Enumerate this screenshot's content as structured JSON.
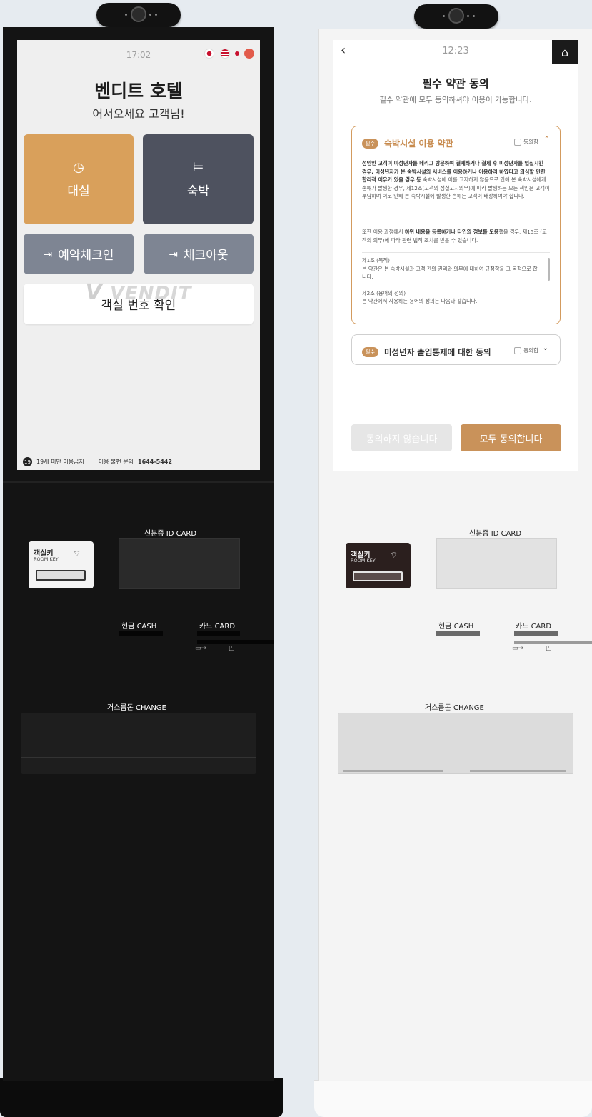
{
  "left_kiosk": {
    "status_time": "17:02",
    "flags": [
      "kr-flag",
      "us-flag",
      "jp-flag",
      "cn-flag"
    ],
    "title": "벤디트 호텔",
    "subtitle": "어서오세요 고객님!",
    "tiles": [
      {
        "label": "대실",
        "icon": "clock-icon"
      },
      {
        "label": "숙박",
        "icon": "bed-icon"
      }
    ],
    "buttons": [
      {
        "label": "예약체크인",
        "icon": "login-icon"
      },
      {
        "label": "체크아웃",
        "icon": "logout-icon"
      }
    ],
    "room_check_label": "객실 번호 확인",
    "brand": "VENDIT",
    "footer": {
      "age_badge": "19",
      "age_text": "19세 미만 이용금지",
      "contact_prefix": "이용 불편 문의",
      "contact_number": "1644-5442"
    },
    "hardware": {
      "room_key_title": "객실키",
      "room_key_sub": "ROOM KEY",
      "id_card": "신분증 ID CARD",
      "cash": "현금 CASH",
      "card": "카드 CARD",
      "change": "거스름돈 CHANGE"
    }
  },
  "right_kiosk": {
    "status_time": "12:23",
    "title": "필수 약관 동의",
    "subtitle": "필수 약관에 모두 동의하셔야 이용이 가능합니다.",
    "required_badge": "필수",
    "agree_label": "동의함",
    "terms": [
      {
        "title": "숙박시설 이용 약관",
        "expanded": true,
        "para1_bold": "성인인 고객이 미성년자를 데리고 방문하여 결제하거나 결제 후 미성년자를 입실시킨 경우, 미성년자가 본 숙박시설의 서비스를 이용하거나 이용하려 하였다고 의심할 만한 합리적 이유가 있을 경우 등",
        "para1_rest": " 숙박시설에 이를 고지하지 않음으로 인해 본 숙박시설에게 손해가 발생한 경우, 제12조(고객의 성실고지의무)에 따라 발생하는 모든 책임은 고객이 부담하며 이로 인해 본 숙박시설에 발생한 손해는 고객이 배상하여야 합니다.",
        "para2_pre": "또한 이용 과정에서 ",
        "para2_bold": "허위 내용을 등록하거나 타인의 정보를 도용",
        "para2_rest": "했을 경우, 제15조 (고객의 의무)에 따라 관련 법적 조치를 받을 수 있습니다.",
        "art1_title": "제1조 (목적)",
        "art1_text": "본 약관은 본 숙박시설과 고객 간의 권리와 의무에 대하여 규정함을 그 목적으로 합니다.",
        "art2_title": "제2조 (용어의 정의)",
        "art2_text": "본 약관에서 사용하는 용어의 정의는 다음과 같습니다."
      },
      {
        "title": "미성년자 출입통제에 대한 동의",
        "expanded": false
      }
    ],
    "disagree_label": "동의하지 않습니다",
    "agree_all_label": "모두 동의합니다",
    "hardware": {
      "room_key_title": "객실키",
      "room_key_sub": "ROOM KEY",
      "id_card": "신분증 ID CARD",
      "cash": "현금 CASH",
      "card": "카드 CARD",
      "change": "거스름돈 CHANGE"
    }
  },
  "colors": {
    "accent_orange": "#d9a05b",
    "tile_dark": "#4e525f",
    "tile_gray": "#7e8593",
    "agree_btn": "#c9925a",
    "disagree_btn": "#e6e6e6"
  }
}
